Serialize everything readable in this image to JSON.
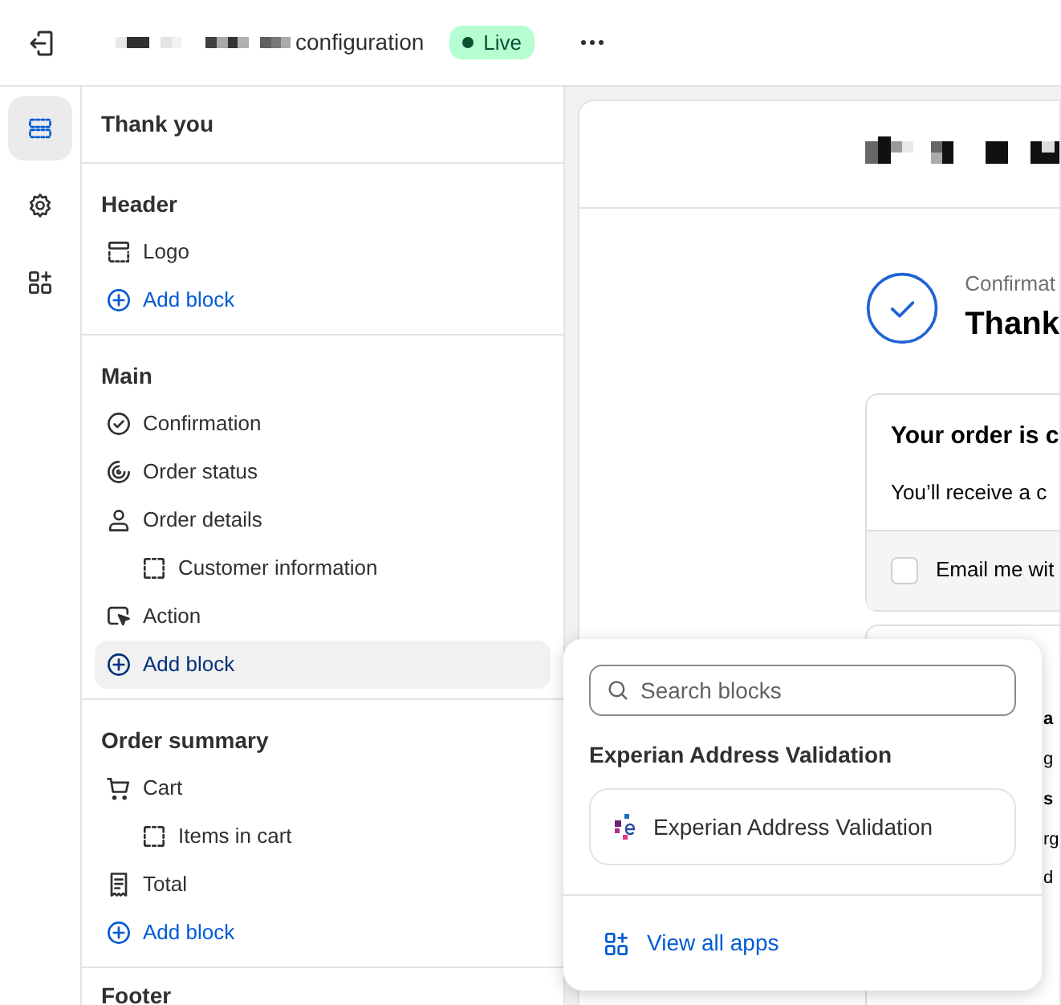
{
  "top_bar": {
    "title": "configuration",
    "status_badge": "Live"
  },
  "rail": [
    {
      "kind": "sections",
      "selected": true
    },
    {
      "kind": "settings",
      "selected": false
    },
    {
      "kind": "apps",
      "selected": false
    }
  ],
  "sidebar": {
    "title": "Thank you",
    "sections": [
      {
        "title": "Header",
        "items": [
          {
            "kind": "logo",
            "label": "Logo",
            "selected": false
          },
          {
            "kind": "add",
            "label": "Add block",
            "selected": false
          }
        ]
      },
      {
        "title": "Main",
        "items": [
          {
            "kind": "check",
            "label": "Confirmation",
            "selected": false
          },
          {
            "kind": "status",
            "label": "Order status",
            "selected": false
          },
          {
            "kind": "person",
            "label": "Order details",
            "selected": false,
            "children": [
              {
                "kind": "block",
                "label": "Customer information",
                "selected": false
              }
            ]
          },
          {
            "kind": "pointer",
            "label": "Action",
            "selected": false
          },
          {
            "kind": "add",
            "label": "Add block",
            "selected": true
          }
        ]
      },
      {
        "title": "Order summary",
        "items": [
          {
            "kind": "cart",
            "label": "Cart",
            "selected": false,
            "children": [
              {
                "kind": "block",
                "label": "Items in cart",
                "selected": false
              }
            ]
          },
          {
            "kind": "receipt",
            "label": "Total",
            "selected": false
          },
          {
            "kind": "add",
            "label": "Add block",
            "selected": false
          }
        ]
      },
      {
        "title": "Footer"
      }
    ]
  },
  "preview": {
    "confirmation_label": "Confirmat",
    "heading": "Thank",
    "order_card": {
      "title": "Your order is c",
      "body": "You’ll receive a c",
      "checkbox": {
        "label": "Email me wit",
        "checked": false
      }
    },
    "second_card_fragments": [
      {
        "kind": "title",
        "text": "a"
      },
      {
        "kind": "body",
        "text": "g"
      },
      {
        "kind": "title",
        "text": "s"
      },
      {
        "kind": "body",
        "text": "rg"
      },
      {
        "kind": "body",
        "text": "d"
      }
    ]
  },
  "popover": {
    "search": {
      "placeholder": "Search blocks"
    },
    "group_title": "Experian Address Validation",
    "apps": [
      {
        "label": "Experian Address Validation"
      }
    ],
    "footer_link": "View all apps"
  }
}
